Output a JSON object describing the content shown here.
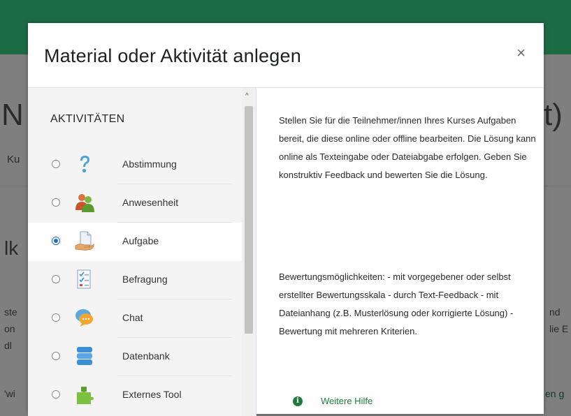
{
  "modal": {
    "title": "Material oder Aktivität anlegen",
    "close_label": "×"
  },
  "activities": {
    "heading": "AKTIVITÄTEN",
    "items": [
      {
        "label": "Abstimmung",
        "icon": "question-mark-icon",
        "selected": false
      },
      {
        "label": "Anwesenheit",
        "icon": "people-icon",
        "selected": false
      },
      {
        "label": "Aufgabe",
        "icon": "assignment-hand-icon",
        "selected": true
      },
      {
        "label": "Befragung",
        "icon": "survey-checklist-icon",
        "selected": false
      },
      {
        "label": "Chat",
        "icon": "chat-bubbles-icon",
        "selected": false
      },
      {
        "label": "Datenbank",
        "icon": "database-icon",
        "selected": false
      },
      {
        "label": "Externes Tool",
        "icon": "puzzle-icon",
        "selected": false
      }
    ]
  },
  "description": {
    "paragraph1": "Stellen Sie für die Teilnehmer/innen Ihres Kurses Aufgaben bereit, die diese online oder offline bearbeiten. Die Lösung kann online als Texteingabe oder Dateiabgabe erfolgen. Geben Sie konstruktiv Feedback und bewerten Sie die Lösung.",
    "paragraph2": "Bewertungsmöglichkeiten: - mit vorgegebener oder selbst erstellter Bewertungsskala - durch Text-Feedback - mit Dateianhang (z.B. Musterlösung oder korrigierte Lösung) - Bewertung mit mehreren Kriterien.",
    "help_icon_glyph": "i",
    "help_link": "Weitere Hilfe"
  },
  "background": {
    "left_heading": "N",
    "left_breadcrumb": "Ku",
    "right_heading": "t)",
    "left_section": "lk",
    "left_lines": [
      "ste",
      "on",
      "dl"
    ],
    "right_lines": [
      "nd",
      "lie E"
    ],
    "bottom_left": "'wi",
    "bottom_right": "en g"
  },
  "colors": {
    "brand_green": "#1d6b45",
    "link_green": "#1e7d3b",
    "radio_blue": "#1d6fc8"
  }
}
